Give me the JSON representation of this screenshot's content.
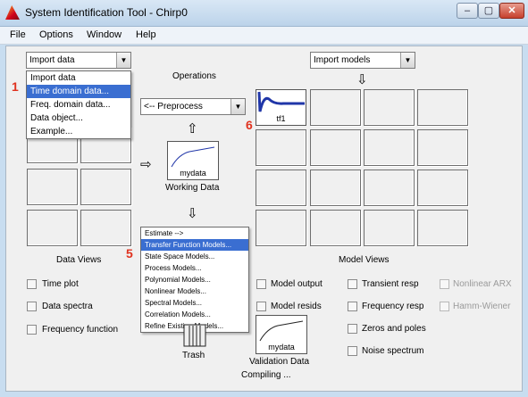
{
  "window": {
    "title": "System Identification Tool - Chirp0",
    "controls": {
      "minimize": "–",
      "maximize": "▢",
      "close": "✕"
    }
  },
  "menu": [
    "File",
    "Options",
    "Window",
    "Help"
  ],
  "import_data": {
    "selected": "Import data",
    "options": [
      "Import data",
      "Time domain data...",
      "Freq. domain data...",
      "Data object...",
      "Example..."
    ],
    "highlighted_index": 1
  },
  "operations": {
    "title": "Operations",
    "preprocess": "<-- Preprocess",
    "estimate_options": [
      "Estimate -->",
      "Transfer Function Models...",
      "State Space Models...",
      "Process Models...",
      "Polynomial Models...",
      "Nonlinear Models...",
      "Spectral Models...",
      "Correlation Models...",
      "Refine Existing Models..."
    ],
    "estimate_highlighted_index": 1
  },
  "working_data": {
    "plot_label": "mydata",
    "caption": "Working Data"
  },
  "import_models": {
    "selected": "Import models"
  },
  "model_tile": {
    "label": "tf1",
    "color": "#2036a8"
  },
  "annotations": {
    "n1": "1",
    "n5": "5",
    "n6": "6",
    "color": "#e0321f"
  },
  "data_views": {
    "title": "Data Views",
    "checkboxes": [
      "Time plot",
      "Data spectra",
      "Frequency function"
    ]
  },
  "model_views": {
    "title": "Model Views",
    "col1": [
      "Model output",
      "Model resids"
    ],
    "col2": [
      "Transient resp",
      "Frequency resp",
      "Zeros and poles",
      "Noise spectrum"
    ],
    "col3_disabled": [
      "Nonlinear ARX",
      "Hamm-Wiener"
    ]
  },
  "trash": {
    "label": "Trash"
  },
  "validation_data": {
    "plot_label": "mydata",
    "caption": "Validation Data"
  },
  "status": "Compiling ..."
}
